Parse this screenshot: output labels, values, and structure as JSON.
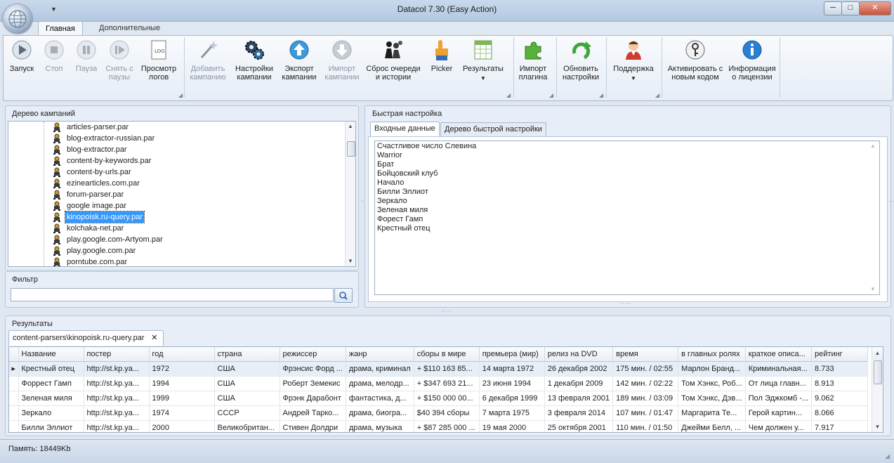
{
  "window": {
    "title": "Datacol 7.30 (Easy Action)",
    "minimize": "─",
    "maximize": "□",
    "close": "✕"
  },
  "ribbon_tabs": [
    "Главная",
    "Дополнительные"
  ],
  "ribbon": {
    "start": "Запуск",
    "stop": "Стоп",
    "pause": "Пауза",
    "unpause": "Снять с паузы",
    "view_logs": "Просмотр логов",
    "add_campaign": "Добавить кампанию",
    "campaign_settings": "Настройки кампании",
    "export_campaign": "Экспорт кампании",
    "import_campaign": "Импорт кампании",
    "reset_queue": "Сброс очереди и истории",
    "picker": "Picker",
    "results": "Результаты",
    "import_plugin": "Импорт плагина",
    "update_settings": "Обновить настройки",
    "support": "Поддержка",
    "activate": "Активировать с новым кодом",
    "license_info": "Информация о лицензии",
    "log_icon_text": "LOG"
  },
  "campaign_tree": {
    "title": "Дерево кампаний",
    "items": [
      "articles-parser.par",
      "blog-extractor-russian.par",
      "blog-extractor.par",
      "content-by-keywords.par",
      "content-by-urls.par",
      "ezinearticles.com.par",
      "forum-parser.par",
      "google image.par",
      "kinopoisk.ru-query.par",
      "kolchaka-net.par",
      "play.google.com-Artyom.par",
      "play.google.com.par",
      "porntube.com.par"
    ],
    "selected": "kinopoisk.ru-query.par"
  },
  "filter": {
    "title": "Фильтр",
    "value": "",
    "placeholder": ""
  },
  "quick_setup": {
    "title": "Быстрая настройка",
    "tabs": [
      "Входные данные",
      "Дерево быстрой настройки"
    ],
    "lines": [
      "Счастливое число Слевина",
      "Warrior",
      "Брат",
      "Бойцовский клуб",
      "Начало",
      "Билли Эллиот",
      "Зеркало",
      "Зеленая миля",
      "Форест Гамп",
      "Крестный отец"
    ]
  },
  "results": {
    "title": "Результаты",
    "tab_label": "content-parsers\\kinopoisk.ru-query.par",
    "tab_close": "✕",
    "columns": [
      "Название",
      "постер",
      "год",
      "страна",
      "режиссер",
      "жанр",
      "сборы в мире",
      "премьера (мир)",
      "релиз на DVD",
      "время",
      "в главных ролях",
      "краткое описа...",
      "рейтинг"
    ],
    "rows": [
      [
        "Крестный отец",
        "http://st.kp.ya...",
        "1972",
        "США",
        "Фрэнсис Форд ...",
        "драма, криминал",
        "+ $110 163 85...",
        "14 марта 1972",
        "26 декабря 2002",
        "175 мин. / 02:55",
        "Марлон Бранд...",
        "Криминальная...",
        "8.733"
      ],
      [
        "Форрест Гамп",
        "http://st.kp.ya...",
        "1994",
        "США",
        "Роберт Земекис",
        "драма, мелодр...",
        "+ $347 693 21...",
        "23 июня 1994",
        "1 декабря 2009",
        "142 мин. / 02:22",
        "Том Хэнкс, Роб...",
        "От лица главн...",
        "8.913"
      ],
      [
        "Зеленая миля",
        "http://st.kp.ya...",
        "1999",
        "США",
        "Фрэнк Дарабонт",
        "фантастика, д...",
        "+ $150 000 00...",
        "6 декабря 1999",
        "13 февраля 2001",
        "189 мин. / 03:09",
        "Том Хэнкс, Дэв...",
        "Пол Эджкомб -...",
        "9.062"
      ],
      [
        "Зеркало",
        "http://st.kp.ya...",
        "1974",
        "СССР",
        "Андрей Тарко...",
        "драма, биогра...",
        "$40 394 сборы",
        "7 марта 1975",
        "3 февраля 2014",
        "107 мин. / 01:47",
        "Маргарита Те...",
        "Герой картин...",
        "8.066"
      ],
      [
        "Билли Эллиот",
        "http://st.kp.ya...",
        "2000",
        "Великобритан...",
        "Стивен Долдри",
        "драма, музыка",
        "+ $87 285 000 ...",
        "19 мая 2000",
        "25 октября 2001",
        "110 мин. / 01:50",
        "Джейми Белл, ...",
        "Чем должен у...",
        "7.917"
      ]
    ],
    "selected_row": 0
  },
  "status": {
    "memory": "Память: 18449Kb"
  },
  "colors": {
    "accent": "#3399ff",
    "frame": "#b7c6d9"
  }
}
